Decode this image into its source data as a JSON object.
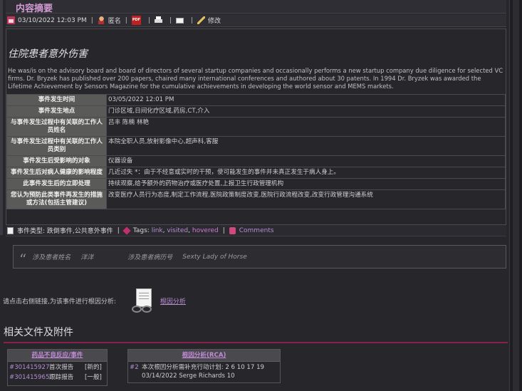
{
  "header": {
    "title": "内容摘要"
  },
  "meta": {
    "datetime": "03/10/2022 12:03 PM",
    "anonymous_label": "匿名",
    "edit_label": "修改",
    "icons": [
      "calendar-icon",
      "user-icon",
      "pdf-icon",
      "print-icon",
      "mail-icon",
      "edit-icon"
    ]
  },
  "report": {
    "title": "住院患者意外伤害",
    "description": "He was/is on the advisory board and board of directors of several startup companies and occasionally performs a new startup company due diligence for selected VC firms. Dr. Bryzek has published over 200 papers, chaired many international conferences and authored about 30 patents. In 1994 Dr. Bryzek was awarded the Lifetime Achievement by Sensors Magazine for the cumulative achievements in developing the world sensor and MEMS markets.",
    "fields": [
      {
        "label": "事件发生时间",
        "value": "03/05/2022 12:01 PM"
      },
      {
        "label": "事件发生地点",
        "value": "门诊区域,日间化疗区域,药房,CT,介入"
      },
      {
        "label": "与事件发生过程中有关联的工作人员姓名",
        "value": "吕丰 陈楠 林艳"
      },
      {
        "label": "与事件发生过程中有关联的工作人员类别",
        "value": "本院全职人员,放射影像中心,超声科,客服"
      },
      {
        "label": "事件发生后受影响的对象",
        "value": "仪器设备"
      },
      {
        "label": "事件发生后对病人健康的影响程度",
        "value": "几近过失 *：由于不经意或实时的干预，使可能发生的事件并未真正发生于病人身上。"
      },
      {
        "label": "此事件发生后的立即处理",
        "value": "持续观察,给予额外的药物治疗或医疗处置,上报卫生行政管理机构"
      },
      {
        "label": "您认为预防此类事件再发生的措施或方法(包括主管建议)",
        "value": "改变医疗人员行为态度,制定工作流程,医院政策制度改变,医院行政流程改变,改变行政管理沟通系统"
      }
    ]
  },
  "footer": {
    "type_label": "事件类型:",
    "type_value": "跌倒事件,公共意外事件",
    "tags_label": "Tags:",
    "tag_link": "link",
    "tag_visited": "visited",
    "tag_hovered": "hovered",
    "comments_label": "Comments"
  },
  "patient": {
    "name_label": "涉及患者姓名",
    "name_value": "洋洋",
    "record_label": "涉及患者病历号",
    "record_value": "Sexty Lady of Horse"
  },
  "rca": {
    "prompt": "请点击右侧链接,为该事件进行根因分析:",
    "link": "根因分析"
  },
  "related": {
    "title": "相关文件及附件",
    "adr_panel": {
      "title": "药品不良反应/事件",
      "rows": [
        {
          "id": "#301415927",
          "name": "首次报告",
          "status": "[新的]"
        },
        {
          "id": "#301415965",
          "name": "跟踪报告",
          "status": "[一般]"
        }
      ]
    },
    "rca_panel": {
      "title": "根因分析(RCA)",
      "id": "#2",
      "line1": "本次根因分析需补充行动计划: 2 6 10 17 19",
      "line2": "03/14/2022  Serge Richards   10"
    }
  },
  "colors": {
    "accent": "#d39ad3",
    "link": "#b68fd0",
    "rule": "#8a2050",
    "label_bg": "#5a5a58"
  }
}
